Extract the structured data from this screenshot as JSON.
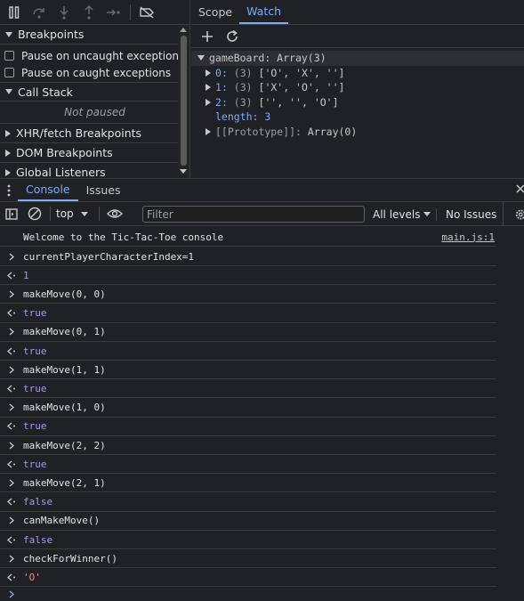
{
  "watch_tabs": [
    "Scope",
    "Watch"
  ],
  "sections": {
    "breakpoints": "Breakpoints",
    "pause_uncaught": "Pause on uncaught exceptions",
    "pause_caught": "Pause on caught exceptions",
    "call_stack": "Call Stack",
    "not_paused": "Not paused",
    "xhr": "XHR/fetch Breakpoints",
    "dom": "DOM Breakpoints",
    "global": "Global Listeners"
  },
  "watch": {
    "root_name": "gameBoard",
    "root_value": "Array(3)",
    "rows": [
      {
        "key": "0",
        "count": "(3)",
        "value": "['O', 'X', '']"
      },
      {
        "key": "1",
        "count": "(3)",
        "value": "['X', 'O', '']"
      },
      {
        "key": "2",
        "count": "(3)",
        "value": "['', '', 'O']"
      }
    ],
    "length_key": "length",
    "length_value": "3",
    "proto_key": "[[Prototype]]",
    "proto_value": "Array(0)"
  },
  "drawer_tabs": [
    "Console",
    "Issues"
  ],
  "console_toolbar": {
    "context": "top",
    "filter_placeholder": "Filter",
    "levels": "All levels",
    "issues": "No Issues"
  },
  "console": {
    "welcome": "Welcome to the Tic-Tac-Toe console",
    "welcome_source": "main.js:1",
    "entries": [
      {
        "input": "currentPlayerCharacterIndex=1",
        "output": "1"
      },
      {
        "input": "makeMove(0, 0)",
        "output": "true"
      },
      {
        "input": "makeMove(0, 1)",
        "output": "true"
      },
      {
        "input": "makeMove(1, 1)",
        "output": "true"
      },
      {
        "input": "makeMove(1, 0)",
        "output": "true"
      },
      {
        "input": "makeMove(2, 2)",
        "output": "true"
      },
      {
        "input": "makeMove(2, 1)",
        "output": "false"
      },
      {
        "input": "canMakeMove()",
        "output": "false"
      },
      {
        "input": "checkForWinner()",
        "output": "'O'"
      }
    ]
  },
  "colors": {
    "accent": "#7cacf8",
    "result": "#9e9cf5",
    "string": "#f28b82",
    "background": "#202124"
  }
}
